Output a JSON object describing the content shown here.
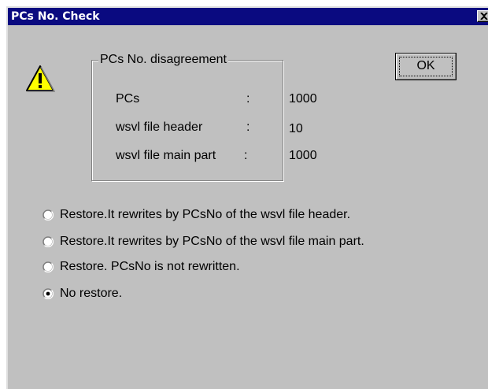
{
  "dialog": {
    "title": "PCs No. Check",
    "close_glyph": "✕",
    "icon": "warning-icon"
  },
  "group": {
    "legend": "PCs No. disagreement",
    "rows": [
      {
        "label": "PCs",
        "sep": ":",
        "value": "1000"
      },
      {
        "label": "wsvl file header",
        "sep": ":",
        "value": "10"
      },
      {
        "label": "wsvl file main part",
        "sep": ":",
        "value": "1000"
      }
    ]
  },
  "ok_button": {
    "label": "OK"
  },
  "options": [
    {
      "label": "Restore.It rewrites by PCsNo of the wsvl file header.",
      "selected": false
    },
    {
      "label": "Restore.It rewrites by PCsNo of the wsvl file main part.",
      "selected": false
    },
    {
      "label": "Restore. PCsNo is not rewritten.",
      "selected": false
    },
    {
      "label": "No restore.",
      "selected": true
    }
  ],
  "colors": {
    "titlebar": "#0a0a80",
    "face": "#c0c0c0",
    "warning": "#ffff00"
  }
}
